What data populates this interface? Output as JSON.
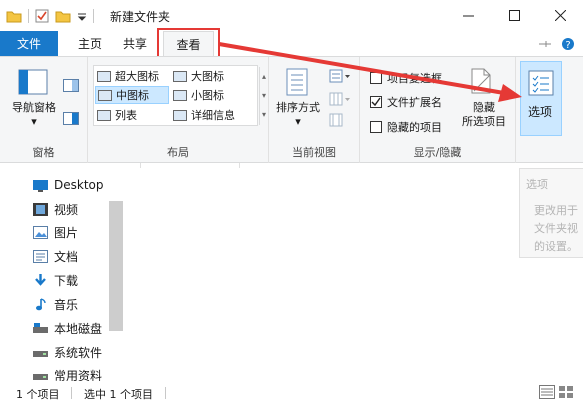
{
  "window": {
    "title": "新建文件夹",
    "minimize": "—",
    "maximize": "☐",
    "close": "✕"
  },
  "tabs": {
    "file": "文件",
    "home": "主页",
    "share": "共享",
    "view": "查看",
    "active": "view"
  },
  "ribbon": {
    "panes": {
      "nav_pane": "导航窗格",
      "group_label": "窗格"
    },
    "layout": {
      "items": [
        "超大图标",
        "大图标",
        "中图标",
        "小图标",
        "列表",
        "详细信息"
      ],
      "selected": "中图标",
      "group_label": "布局"
    },
    "current_view": {
      "sort_by": "排序方式",
      "group_label": "当前视图"
    },
    "show_hide": {
      "checkbox_item": "项目复选框",
      "file_extension": "文件扩展名",
      "hidden_items": "隐藏的项目",
      "file_extension_checked": true,
      "hide_selected_line1": "隐藏",
      "hide_selected_line2": "所选项目",
      "group_label": "显示/隐藏"
    },
    "options": {
      "label": "选项"
    }
  },
  "tooltip": {
    "title": "选项",
    "line1": "更改用于",
    "line2": "文件夹视",
    "line3": "的设置。"
  },
  "nav": {
    "items": [
      "Desktop",
      "视频",
      "图片",
      "文档",
      "下载",
      "音乐",
      "本地磁盘",
      "系统软件",
      "常用资料"
    ]
  },
  "status": {
    "count": "1 个项目",
    "selected": "选中 1 个项目"
  },
  "colors": {
    "accent": "#1979ca",
    "highlight": "#e53935",
    "selection": "#cce8ff"
  }
}
